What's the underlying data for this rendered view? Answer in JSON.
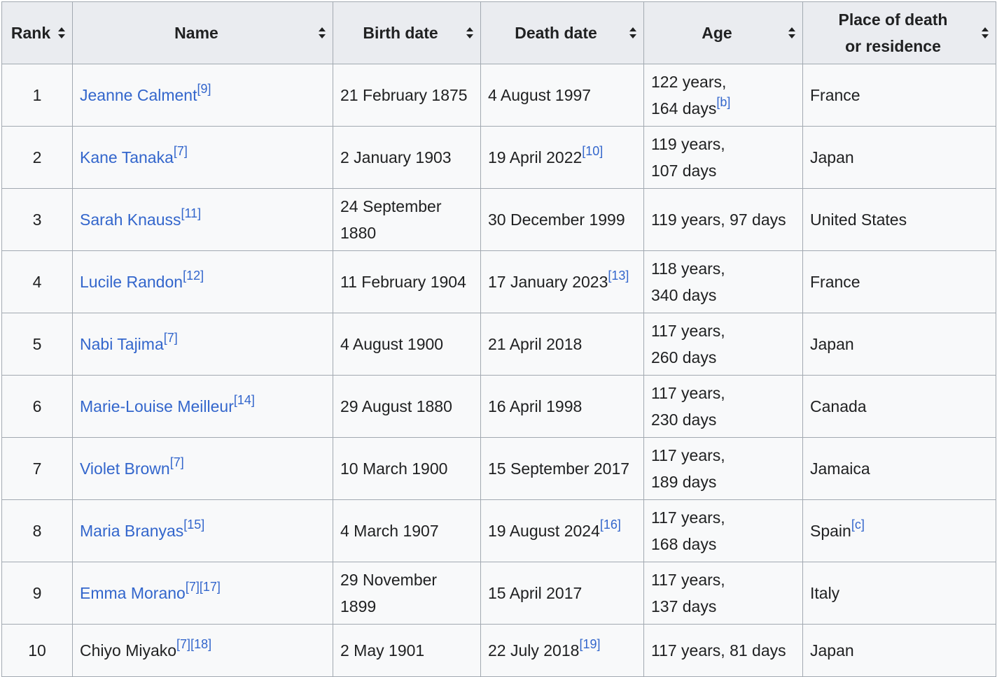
{
  "headers": {
    "rank": "Rank",
    "name": "Name",
    "birth": "Birth date",
    "death": "Death date",
    "age": "Age",
    "place_line1": "Place of death",
    "place_line2": "or residence"
  },
  "rows": [
    {
      "rank": "1",
      "name": "Jeanne Calment",
      "name_refs": [
        "[9]"
      ],
      "birth": "21 February 1875",
      "death": "4 August 1997",
      "death_refs": [],
      "age_line1": "122 years,",
      "age_line2": "164 days",
      "age_refs": [
        "[b]"
      ],
      "place": "France",
      "place_refs": [],
      "linked": true
    },
    {
      "rank": "2",
      "name": "Kane Tanaka",
      "name_refs": [
        "[7]"
      ],
      "birth": "2 January 1903",
      "death": "19 April 2022",
      "death_refs": [
        "[10]"
      ],
      "age_line1": "119 years,",
      "age_line2": "107 days",
      "age_refs": [],
      "place": "Japan",
      "place_refs": [],
      "linked": true
    },
    {
      "rank": "3",
      "name": "Sarah Knauss",
      "name_refs": [
        "[11]"
      ],
      "birth_line1": "24 September",
      "birth_line2": "1880",
      "death": "30 December 1999",
      "death_refs": [],
      "age": "119 years, 97 days",
      "age_refs": [],
      "place": "United States",
      "place_refs": [],
      "linked": true
    },
    {
      "rank": "4",
      "name": "Lucile Randon",
      "name_refs": [
        "[12]"
      ],
      "birth": "11 February 1904",
      "death": "17 January 2023",
      "death_refs": [
        "[13]"
      ],
      "age_line1": "118 years,",
      "age_line2": "340 days",
      "age_refs": [],
      "place": "France",
      "place_refs": [],
      "linked": true
    },
    {
      "rank": "5",
      "name": "Nabi Tajima",
      "name_refs": [
        "[7]"
      ],
      "birth": "4 August 1900",
      "death": "21 April 2018",
      "death_refs": [],
      "age_line1": "117 years,",
      "age_line2": "260 days",
      "age_refs": [],
      "place": "Japan",
      "place_refs": [],
      "linked": true
    },
    {
      "rank": "6",
      "name": "Marie-Louise Meilleur",
      "name_refs": [
        "[14]"
      ],
      "birth": "29 August 1880",
      "death": "16 April 1998",
      "death_refs": [],
      "age_line1": "117 years,",
      "age_line2": "230 days",
      "age_refs": [],
      "place": "Canada",
      "place_refs": [],
      "linked": true
    },
    {
      "rank": "7",
      "name": "Violet Brown",
      "name_refs": [
        "[7]"
      ],
      "birth": "10 March 1900",
      "death": "15 September 2017",
      "death_refs": [],
      "age_line1": "117 years,",
      "age_line2": "189 days",
      "age_refs": [],
      "place": "Jamaica",
      "place_refs": [],
      "linked": true
    },
    {
      "rank": "8",
      "name": "Maria Branyas",
      "name_refs": [
        "[15]"
      ],
      "birth": "4 March 1907",
      "death": "19 August 2024",
      "death_refs": [
        "[16]"
      ],
      "age_line1": "117 years,",
      "age_line2": "168 days",
      "age_refs": [],
      "place": "Spain",
      "place_refs": [
        "[c]"
      ],
      "linked": true
    },
    {
      "rank": "9",
      "name": "Emma Morano",
      "name_refs": [
        "[7]",
        "[17]"
      ],
      "birth_line1": "29 November",
      "birth_line2": "1899",
      "death": "15 April 2017",
      "death_refs": [],
      "age_line1": "117 years,",
      "age_line2": "137 days",
      "age_refs": [],
      "place": "Italy",
      "place_refs": [],
      "linked": true
    },
    {
      "rank": "10",
      "name": "Chiyo Miyako",
      "name_refs": [
        "[7]",
        "[18]"
      ],
      "birth": "2 May 1901",
      "death": "22 July 2018",
      "death_refs": [
        "[19]"
      ],
      "age": "117 years, 81 days",
      "age_refs": [],
      "place": "Japan",
      "place_refs": [],
      "linked": false
    }
  ],
  "colors": {
    "link": "#3366cc",
    "header_bg": "#eaecf0",
    "cell_bg": "#f8f9fa",
    "border": "#a2a9b1"
  }
}
